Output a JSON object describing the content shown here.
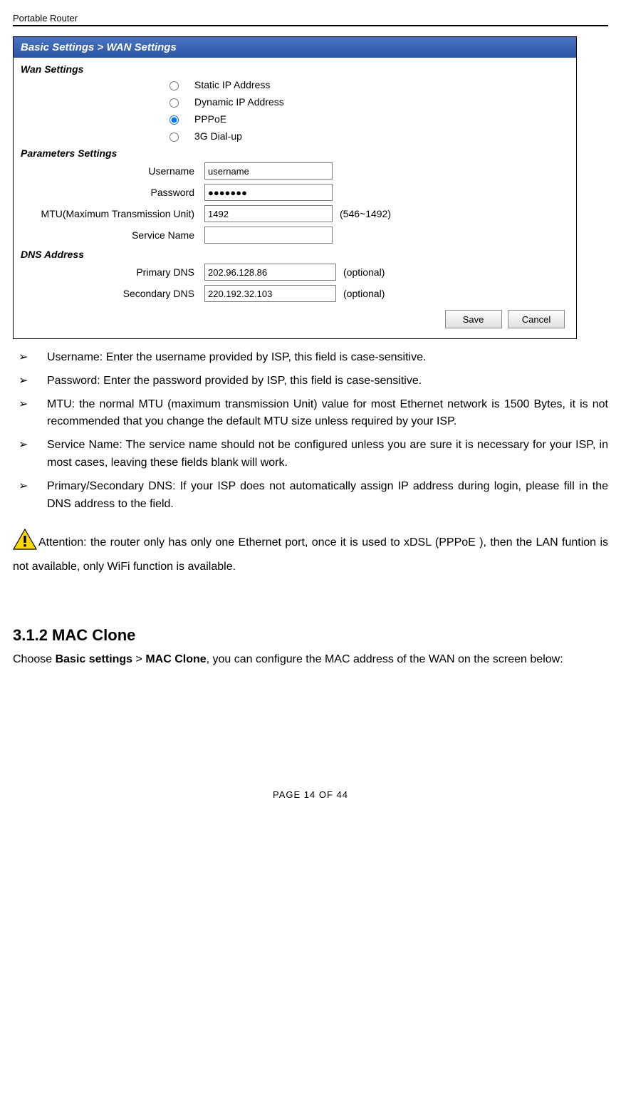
{
  "doc": {
    "header": "Portable Router",
    "footer": "PAGE    14    OF    44"
  },
  "screenshot": {
    "breadcrumb": "Basic Settings > WAN Settings",
    "wan_settings_title": "Wan Settings",
    "radios": {
      "static": "Static IP Address",
      "dynamic": "Dynamic IP Address",
      "pppoe": "PPPoE",
      "dialup": "3G Dial-up"
    },
    "params_title": "Parameters Settings",
    "labels": {
      "username": "Username",
      "password": "Password",
      "mtu": "MTU(Maximum Transmission Unit)",
      "service": "Service Name",
      "mtu_hint": "(546~1492)"
    },
    "values": {
      "username": "username",
      "password": "●●●●●●●",
      "mtu": "1492",
      "service": ""
    },
    "dns_title": "DNS Address",
    "dns_labels": {
      "primary": "Primary DNS",
      "secondary": "Secondary DNS",
      "optional": "(optional)"
    },
    "dns_values": {
      "primary": "202.96.128.86",
      "secondary": "220.192.32.103"
    },
    "buttons": {
      "save": "Save",
      "cancel": "Cancel"
    }
  },
  "bullets": {
    "sym": "➢",
    "items": [
      "Username: Enter the username provided by ISP, this field is case-sensitive.",
      "Password: Enter the password provided by ISP, this field is case-sensitive.",
      "MTU: the normal MTU (maximum transmission Unit) value for most Ethernet network is 1500 Bytes, it is not recommended that you change the default MTU size unless required by your ISP.",
      "Service Name: The service name should not be configured unless you are sure it is necessary for your ISP, in most cases, leaving these fields blank will work.",
      "Primary/Secondary DNS: If your ISP does not automatically assign IP address during login, please fill in the DNS address to the field."
    ]
  },
  "attention": "Attention: the router only has only one Ethernet port, once it is used to xDSL (PPPoE ), then the LAN funtion is not available, only WiFi function is available.",
  "section": {
    "heading": "3.1.2 MAC Clone",
    "para_pre": "Choose ",
    "para_b1": "Basic settings",
    "para_gt": " > ",
    "para_b2": "MAC Clone",
    "para_post": ", you can configure the MAC address of the WAN on the screen below:"
  }
}
